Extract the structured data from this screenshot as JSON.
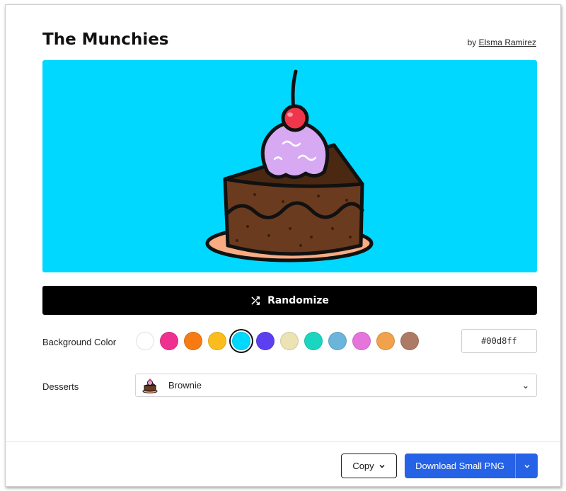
{
  "header": {
    "title": "The Munchies",
    "by_prefix": "by",
    "author": "Elsma Ramirez"
  },
  "canvas": {
    "background": "#00d8ff"
  },
  "actions": {
    "randomize_label": "Randomize"
  },
  "background_color": {
    "label": "Background Color",
    "selected_index": 4,
    "options": [
      "#ffffff",
      "#f0308f",
      "#f77a12",
      "#fbbd1c",
      "#00d8ff",
      "#5b3ff0",
      "#ebe3b4",
      "#1ad6c0",
      "#6bb4da",
      "#e575dc",
      "#f0a24c",
      "#ad7a66"
    ],
    "hex_value": "#00d8ff"
  },
  "desserts": {
    "label": "Desserts",
    "selected": "Brownie"
  },
  "footer": {
    "copy_label": "Copy",
    "download_label": "Download Small PNG"
  }
}
